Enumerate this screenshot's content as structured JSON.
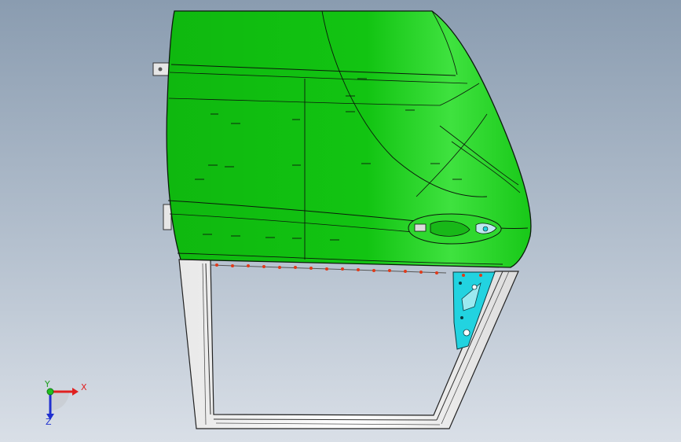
{
  "viewport": {
    "background_top": "#8a9cb0",
    "background_bottom": "#d9dfe7"
  },
  "model": {
    "panel_color": "#11c211",
    "panel_highlight": "#3fe23f",
    "edge_color": "#0b1a0b",
    "frame_color": "#f4f4f4",
    "bracket_color": "#22d3e0",
    "seal_dot_color": "#e03b1a"
  },
  "triad": {
    "x_label": "X",
    "y_label": "Y",
    "z_label": "Z",
    "x_color": "#e02020",
    "y_color": "#20a020",
    "z_color": "#2030d0"
  }
}
